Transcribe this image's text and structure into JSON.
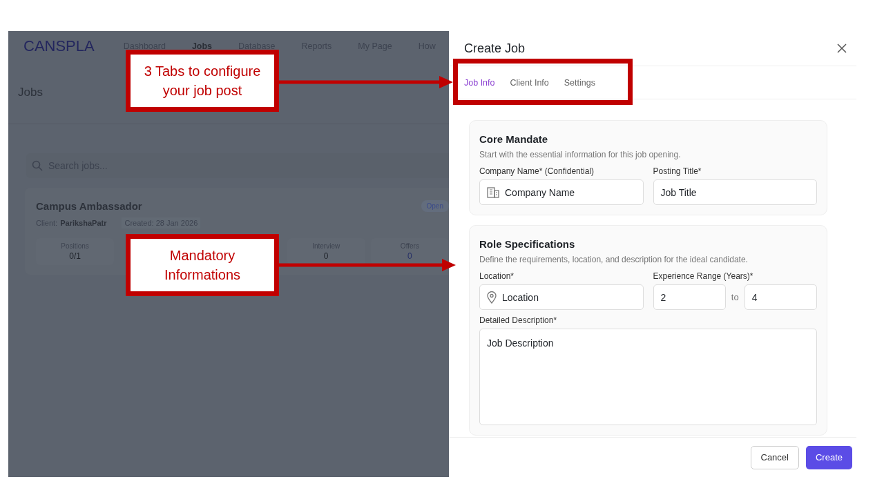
{
  "app": {
    "logo": "CANSPLA",
    "nav": [
      {
        "label": "Dashboard",
        "selected": false
      },
      {
        "label": "Jobs",
        "selected": true
      },
      {
        "label": "Database",
        "selected": false
      },
      {
        "label": "Reports",
        "selected": false
      },
      {
        "label": "My Page",
        "selected": false
      },
      {
        "label": "How",
        "selected": false
      }
    ],
    "page_title": "Jobs",
    "search": {
      "placeholder": "Search jobs..."
    },
    "job": {
      "title": "Campus Ambassador",
      "client_label": "Client:",
      "client": "ParikshaPatr",
      "created": "Created: 28 Jan 2026",
      "status": "Open",
      "stats": [
        {
          "label": "Positions",
          "value": "0/1"
        },
        {
          "label": "Interview",
          "value": "0"
        },
        {
          "label": "Offers",
          "value": "0"
        }
      ]
    }
  },
  "drawer": {
    "title": "Create Job",
    "tabs": [
      {
        "label": "Job Info",
        "selected": true
      },
      {
        "label": "Client Info",
        "selected": false
      },
      {
        "label": "Settings",
        "selected": false
      }
    ],
    "sections": [
      {
        "title": "Core Mandate",
        "subtitle": "Start with the essential information for this job opening.",
        "fields": [
          {
            "kind": "company",
            "label": "Company Name* (Confidential)",
            "value": "Company Name"
          },
          {
            "kind": "text",
            "label": "Posting Title*",
            "value": "Job Title"
          }
        ]
      },
      {
        "title": "Role Specifications",
        "subtitle": "Define the requirements, location, and description for the ideal candidate.",
        "fields": [
          {
            "kind": "location",
            "label": "Location*",
            "value": "Location"
          },
          {
            "kind": "range",
            "label": "Experience Range (Years)*",
            "from": "2",
            "separator": "to",
            "to": "4"
          },
          {
            "kind": "textarea",
            "label": "Detailed Description*",
            "value": "Job Description"
          }
        ]
      }
    ],
    "buttons": [
      {
        "label": "Cancel",
        "kind": "secondary"
      },
      {
        "label": "Create",
        "kind": "primary"
      }
    ]
  },
  "callouts": [
    {
      "text": "3 Tabs to configure your job post"
    },
    {
      "text": "Mandatory Informations"
    }
  ]
}
